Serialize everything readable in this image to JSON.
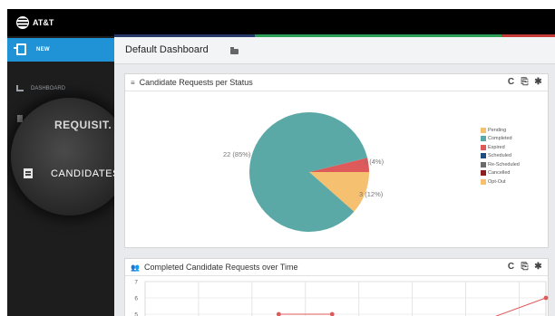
{
  "brand": {
    "name": "AT&T"
  },
  "sidebar": {
    "new_label": "NEW",
    "dashboard_label": "DASHBOARD",
    "requisitions_label": "REQUISIT.",
    "candidates_label": "CANDIDATES"
  },
  "header": {
    "title": "Default Dashboard"
  },
  "panel1": {
    "title": "Candidate Requests per Status",
    "tools": {
      "refresh": "C",
      "copy": "⎘",
      "settings": "✱"
    }
  },
  "panel2": {
    "title": "Completed Candidate Requests over Time",
    "tools": {
      "refresh": "C",
      "copy": "⎘",
      "settings": "✱"
    }
  },
  "colors": {
    "accent": "#1f93d6",
    "completed": "#5aa9a6",
    "expired": "#de5a5a",
    "opt_out": "#f5c06f"
  },
  "chart_data": [
    {
      "type": "pie",
      "title": "Candidate Requests per Status",
      "slices": [
        {
          "label": "Completed",
          "value": 22,
          "percent": 85,
          "color": "#5aa9a6",
          "data_label": "22 (85%)"
        },
        {
          "label": "Expired",
          "value": 1,
          "percent": 4,
          "color": "#de5a5a",
          "data_label": "1 (4%)"
        },
        {
          "label": "Opt-Out",
          "value": 3,
          "percent": 12,
          "color": "#f5c06f",
          "data_label": "3 (12%)"
        }
      ],
      "legend": [
        {
          "label": "Pending",
          "color": "#f5c06f"
        },
        {
          "label": "Completed",
          "color": "#5aa9a6"
        },
        {
          "label": "Expired",
          "color": "#de5a5a"
        },
        {
          "label": "Scheduled",
          "color": "#1f4e7a"
        },
        {
          "label": "Re-Scheduled",
          "color": "#6b6b6b"
        },
        {
          "label": "Cancelled",
          "color": "#8b1f1f"
        },
        {
          "label": "Opt-Out",
          "color": "#f5c06f"
        }
      ],
      "legend_position": "top-right"
    },
    {
      "type": "line",
      "title": "Completed Candidate Requests over Time",
      "y_ticks": [
        "7",
        "6",
        "5"
      ],
      "ylim": [
        5,
        7
      ],
      "series": [
        {
          "x": [
            2.5,
            3.5
          ],
          "y": [
            5,
            5
          ]
        },
        {
          "x": [
            6.5,
            7.5
          ],
          "y": [
            4.8,
            6
          ]
        }
      ],
      "xlim": [
        0,
        7.5
      ],
      "color": "#de5a5a",
      "grid": true
    }
  ]
}
